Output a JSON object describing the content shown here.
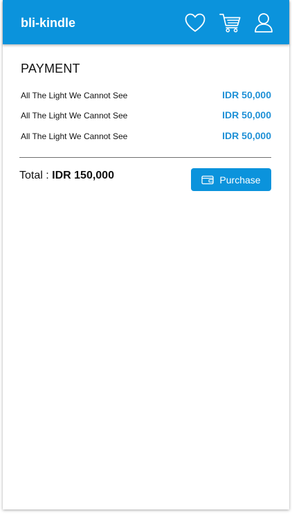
{
  "app": {
    "brand": "bli-kindle",
    "accent_color": "#0b93dc",
    "icons": [
      "heart-icon",
      "cart-icon",
      "user-icon"
    ]
  },
  "payment": {
    "title": "PAYMENT",
    "items": [
      {
        "title": "All The Light We Cannot See",
        "price": "IDR 50,000"
      },
      {
        "title": "All The Light We Cannot See",
        "price": "IDR 50,000"
      },
      {
        "title": "All The Light We Cannot See",
        "price": "IDR 50,000"
      }
    ],
    "total_label": "Total :",
    "total_amount": "IDR 150,000",
    "purchase_label": "Purchase"
  }
}
